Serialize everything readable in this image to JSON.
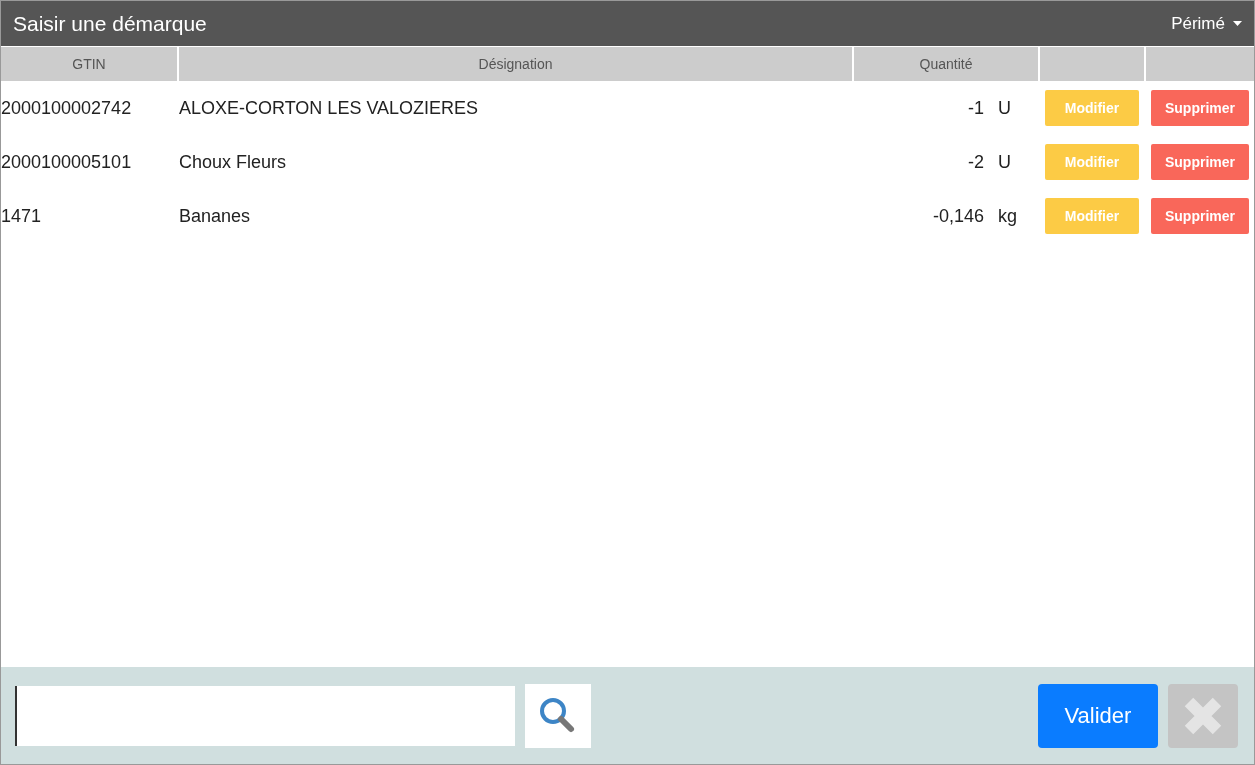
{
  "window": {
    "title": "Saisir une démarque",
    "reason_menu": "Périmé"
  },
  "table": {
    "columns": [
      "GTIN",
      "Désignation",
      "Quantité"
    ],
    "rows": [
      {
        "gtin": "2000100002742",
        "designation": "ALOXE-CORTON LES VALOZIERES",
        "quantity": "-1",
        "unit": "U",
        "edit": "Modifier",
        "delete": "Supprimer"
      },
      {
        "gtin": "2000100005101",
        "designation": "Choux Fleurs",
        "quantity": "-2",
        "unit": "U",
        "edit": "Modifier",
        "delete": "Supprimer"
      },
      {
        "gtin": "1471",
        "designation": "Bananes",
        "quantity": "-0,146",
        "unit": "kg",
        "edit": "Modifier",
        "delete": "Supprimer"
      }
    ]
  },
  "footer": {
    "validate": "Valider",
    "close_disabled": true
  }
}
